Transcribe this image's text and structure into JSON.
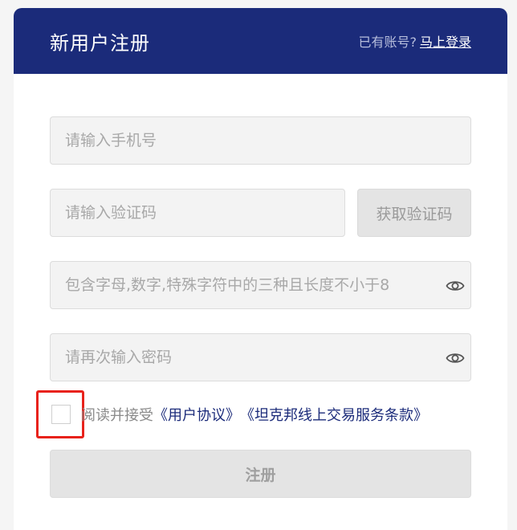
{
  "header": {
    "title": "新用户注册",
    "login_prompt": "已有账号?",
    "login_link": "马上登录"
  },
  "form": {
    "phone_placeholder": "请输入手机号",
    "code_placeholder": "请输入验证码",
    "get_code_label": "获取验证码",
    "password_placeholder": "包含字母,数字,特殊字符中的三种且长度不小于8",
    "confirm_placeholder": "请再次输入密码",
    "agreement_prefix": "阅读并接受",
    "agreement_user": "《用户协议》",
    "agreement_terms": "《坦克邦线上交易服务条款》",
    "agreement_checked": false,
    "submit_label": "注册"
  },
  "icons": {
    "password_toggle": "eye-icon",
    "confirm_toggle": "eye-icon"
  },
  "colors": {
    "header_bg": "#1b2b7a",
    "link": "#1b2b7a",
    "highlight_border": "#e8221b"
  }
}
